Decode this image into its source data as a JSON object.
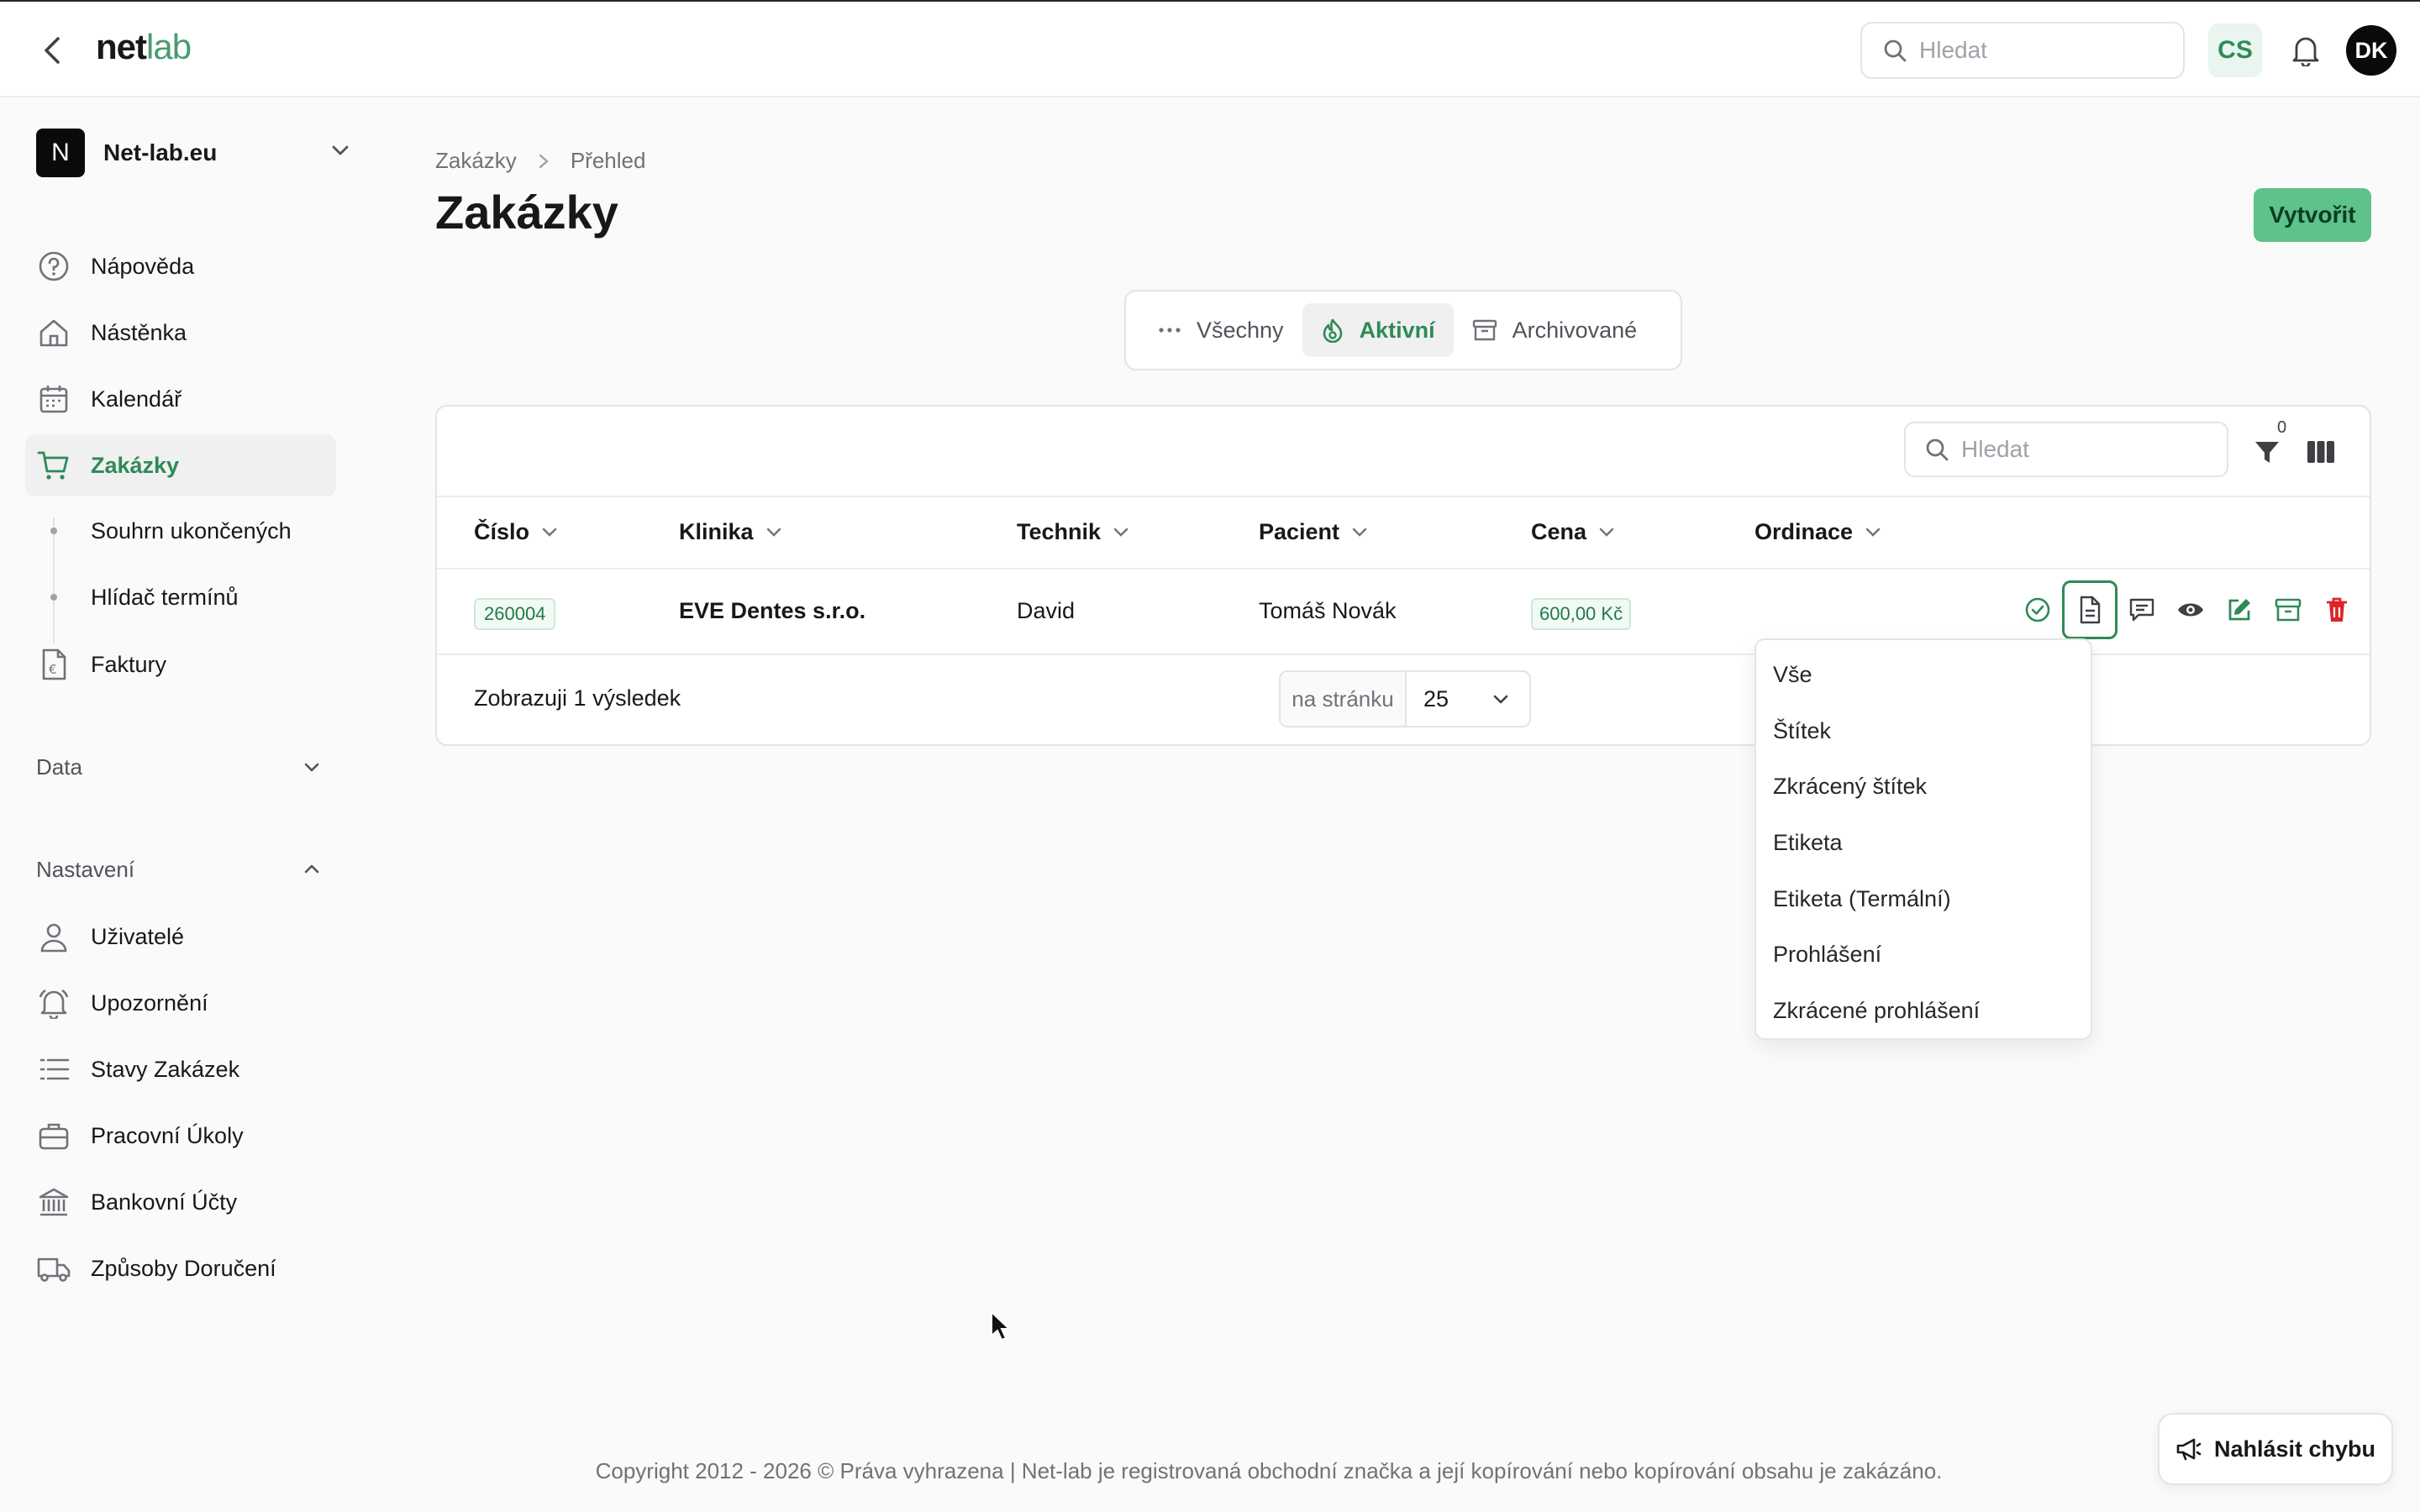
{
  "topbar": {
    "logo_net": "net",
    "logo_lab": "lab",
    "search_placeholder": "Hledat",
    "language": "CS",
    "avatar_initials": "DK"
  },
  "sidebar": {
    "org_initial": "N",
    "org_name": "Net-lab.eu",
    "items": [
      {
        "label": "Nápověda",
        "icon": "help-circle-icon"
      },
      {
        "label": "Nástěnka",
        "icon": "home-icon"
      },
      {
        "label": "Kalendář",
        "icon": "calendar-icon"
      },
      {
        "label": "Zakázky",
        "icon": "cart-icon",
        "active": true
      },
      {
        "label": "Souhrn ukončených"
      },
      {
        "label": "Hlídač termínů"
      },
      {
        "label": "Faktury",
        "icon": "invoice-icon"
      }
    ],
    "section_data": "Data",
    "section_settings": "Nastavení",
    "settings_items": [
      {
        "label": "Uživatelé",
        "icon": "user-icon"
      },
      {
        "label": "Upozornění",
        "icon": "bell-icon"
      },
      {
        "label": "Stavy Zakázek",
        "icon": "list-icon"
      },
      {
        "label": "Pracovní Úkoly",
        "icon": "briefcase-icon"
      },
      {
        "label": "Bankovní Účty",
        "icon": "bank-icon"
      },
      {
        "label": "Způsoby Doručení",
        "icon": "truck-icon"
      }
    ]
  },
  "breadcrumb": {
    "root": "Zakázky",
    "current": "Přehled"
  },
  "page": {
    "title": "Zakázky",
    "create_label": "Vytvořit"
  },
  "tabs": [
    {
      "label": "Všechny",
      "icon": "dots-icon"
    },
    {
      "label": "Aktivní",
      "icon": "flame-icon",
      "active": true
    },
    {
      "label": "Archivované",
      "icon": "archive-icon"
    }
  ],
  "table": {
    "search_placeholder": "Hledat",
    "filter_count": "0",
    "columns": [
      "Číslo",
      "Klinika",
      "Technik",
      "Pacient",
      "Cena",
      "Ordinace"
    ],
    "rows": [
      {
        "cislo": "260004",
        "klinika": "EVE Dentes s.r.o.",
        "technik": "David",
        "pacient": "Tomáš Novák",
        "cena": "600,00 Kč",
        "ordinace": ""
      }
    ],
    "result_text": "Zobrazuji 1 výsledek",
    "per_page_label": "na stránku",
    "per_page_value": "25"
  },
  "print_menu": [
    "Vše",
    "Štítek",
    "Zkrácený štítek",
    "Etiketa",
    "Etiketa (Termální)",
    "Prohlášení",
    "Zkrácené prohlášení"
  ],
  "footer": {
    "copyright": "Copyright 2012 - 2026 © Práva vyhrazena | Net-lab je registrovaná obchodní značka a její kopírování nebo kopírování obsahu je zakázáno.",
    "report_label": "Nahlásit chybu"
  },
  "colors": {
    "accent": "#2f8a57",
    "create_button": "#5ec28a",
    "delete": "#dc2626"
  }
}
